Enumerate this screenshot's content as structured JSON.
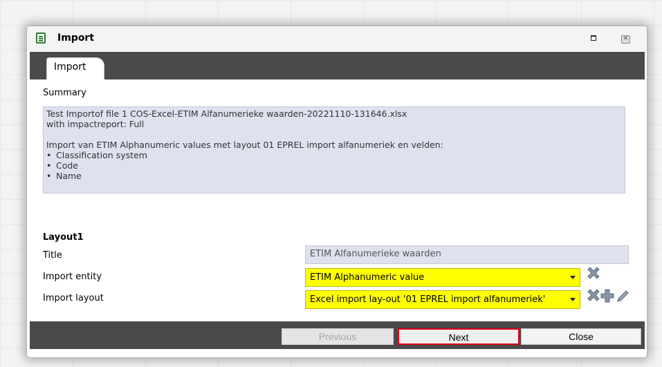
{
  "window": {
    "title": "Import"
  },
  "tabs": [
    {
      "label": "Import"
    }
  ],
  "summary": {
    "label": "Summary",
    "lines": [
      "Test Importof file 1 COS-Excel-ETIM Alfanumerieke waarden-20221110-131646.xlsx",
      "with impactreport: Full",
      "",
      "Import van ETIM Alphanumeric values met layout 01 EPREL import alfanumeriek en velden:"
    ],
    "fields": [
      "Classification system",
      "Code",
      "Name"
    ]
  },
  "layout": {
    "heading": "Layout1",
    "title_label": "Title",
    "title_value": "ETIM Alfanumerieke waarden",
    "entity_label": "Import entity",
    "entity_value": "ETIM Alphanumeric value",
    "layout_label": "Import layout",
    "layout_value": "Excel import lay-out '01 EPREL import alfanumeriek'"
  },
  "footer": {
    "previous": "Previous",
    "next": "Next",
    "close": "Close"
  },
  "colors": {
    "highlight": "#ffff00",
    "summary_bg": "#dfe1ef",
    "next_border": "#e0001a",
    "bar": "#4a4a4a"
  },
  "icons": [
    "document-icon",
    "maximize-icon",
    "close-icon",
    "delete-icon",
    "add-icon",
    "edit-icon",
    "chevron-down-icon"
  ]
}
